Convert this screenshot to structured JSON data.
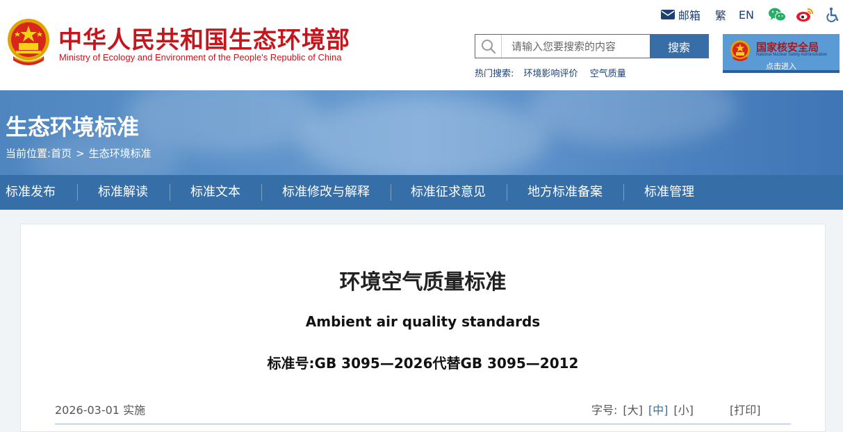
{
  "header": {
    "site_title_cn": "中华人民共和国生态环境部",
    "site_title_en": "Ministry of Ecology and Environment of the People's Republic of China",
    "links": {
      "mail": "邮箱",
      "traditional": "繁",
      "english": "EN"
    },
    "search": {
      "placeholder": "请输入您要搜索的内容",
      "button": "搜索"
    },
    "hot_search": {
      "label": "热门搜索:",
      "items": [
        "环境影响评价",
        "空气质量"
      ]
    },
    "nnsa": {
      "name_cn": "国家核安全局",
      "name_en": "National Nuclear Safety Administration",
      "enter": "点击进入"
    }
  },
  "banner": {
    "title": "生态环境标准",
    "breadcrumb": {
      "prefix": "当前位置:",
      "home": "首页",
      "separator": ">",
      "current": "生态环境标准"
    }
  },
  "nav": {
    "items": [
      "标准发布",
      "标准解读",
      "标准文本",
      "标准修改与解释",
      "标准征求意见",
      "地方标准备案",
      "标准管理"
    ]
  },
  "document": {
    "title_cn": "环境空气质量标准",
    "title_en": "Ambient air quality standards",
    "standard_no": "标准号:GB 3095—2026代替GB 3095—2012",
    "effective": "2026-03-01 实施",
    "font_size": {
      "label": "字号:",
      "options": [
        "[大]",
        "[中]",
        "[小]"
      ],
      "active": "[中]"
    },
    "print": "[打印]"
  },
  "colors": {
    "brand_red": "#c4161c",
    "nav_blue": "#366fa8",
    "link_blue": "#1d3f74"
  }
}
